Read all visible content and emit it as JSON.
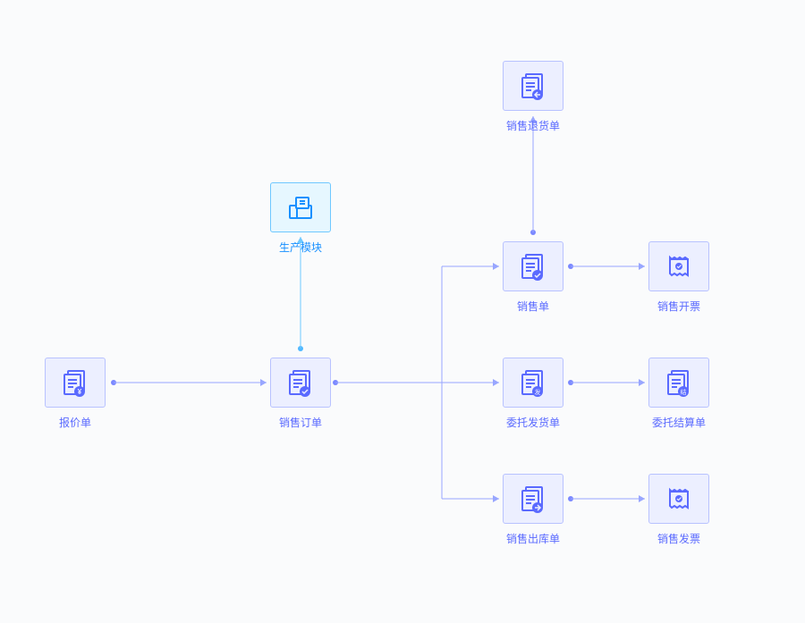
{
  "nodes": {
    "quote": {
      "label": "报价单",
      "icon": "doc-yen"
    },
    "sales_order": {
      "label": "销售订单",
      "icon": "doc-check"
    },
    "production_module": {
      "label": "生产模块",
      "icon": "module-box"
    },
    "sales_return": {
      "label": "销售退货单",
      "icon": "doc-return"
    },
    "sales_bill": {
      "label": "销售单",
      "icon": "doc-check"
    },
    "sales_invoice_open": {
      "label": "销售开票",
      "icon": "receipt-check"
    },
    "consign_ship": {
      "label": "委托发货单",
      "icon": "doc-fa"
    },
    "consign_settle": {
      "label": "委托结算单",
      "icon": "doc-jie"
    },
    "sales_out": {
      "label": "销售出库单",
      "icon": "doc-out"
    },
    "sales_invoice": {
      "label": "销售发票",
      "icon": "receipt-check"
    }
  }
}
